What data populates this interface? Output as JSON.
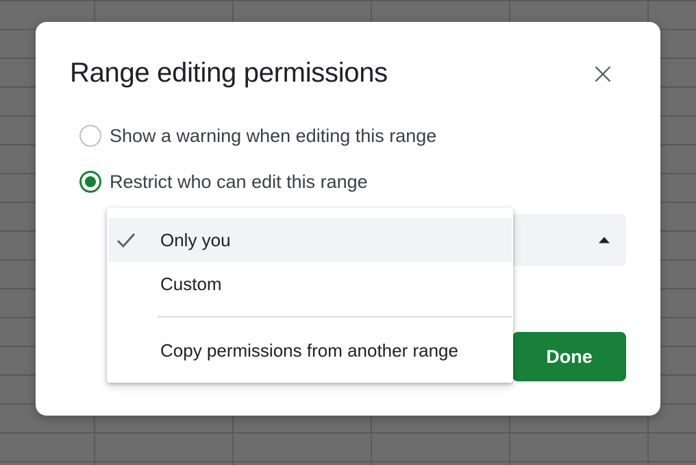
{
  "dialog": {
    "title": "Range editing permissions"
  },
  "options": {
    "warning_label": "Show a warning when editing this range",
    "restrict_label": "Restrict who can edit this range",
    "selected": "restrict"
  },
  "dropdown": {
    "items": [
      {
        "label": "Only you",
        "selected": true
      },
      {
        "label": "Custom",
        "selected": false
      },
      {
        "label": "Copy permissions from another range",
        "selected": false
      }
    ]
  },
  "buttons": {
    "done_label": "Done"
  },
  "icons": {
    "close": "close-icon",
    "check": "check-icon",
    "dropdown_arrow": "caret-up-icon"
  },
  "colors": {
    "accent": "#188038",
    "backdrop": "#6d6d6d"
  }
}
